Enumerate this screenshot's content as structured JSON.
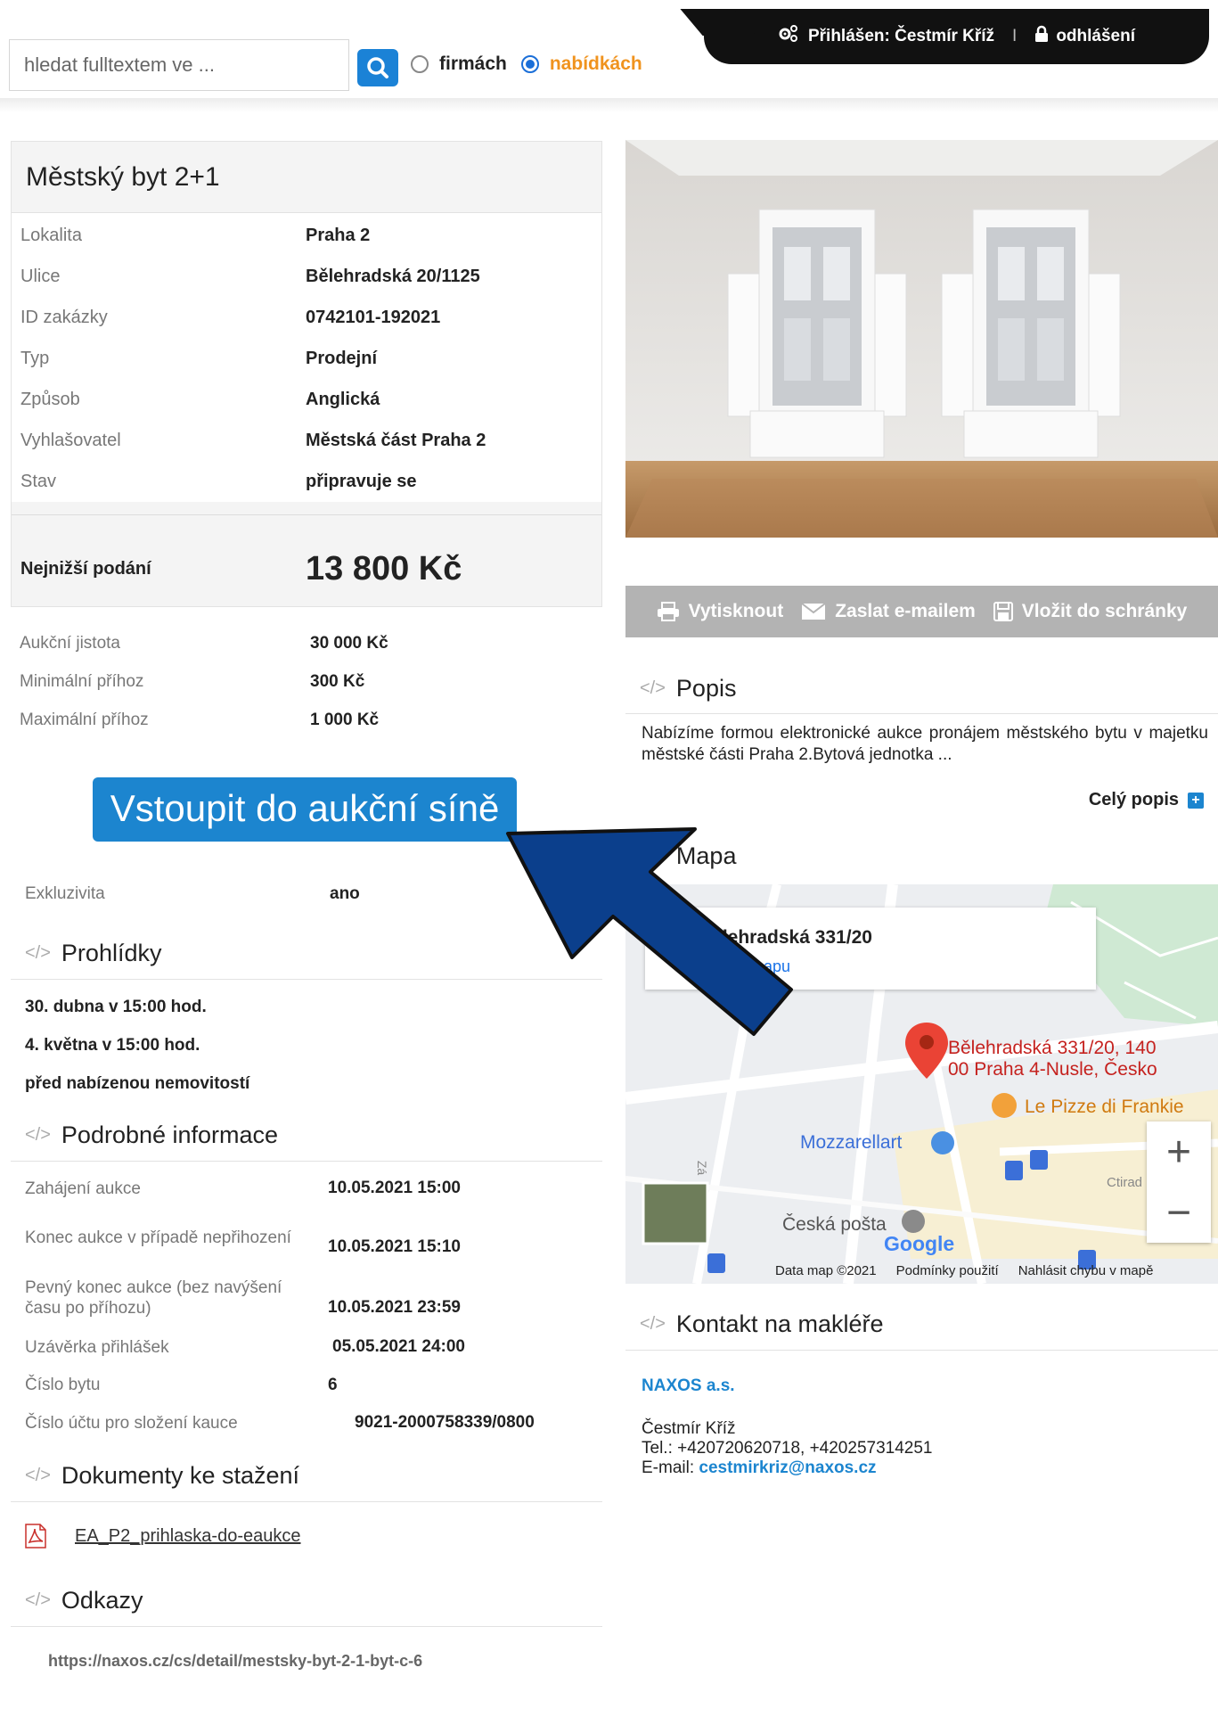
{
  "search": {
    "placeholder": "hledat fulltextem ve ...",
    "options": [
      {
        "label": "firmách",
        "selected": false
      },
      {
        "label": "nabídkách",
        "selected": true
      }
    ]
  },
  "user": {
    "logged_in": "Přihlášen: Čestmír Kříž",
    "separator": "I",
    "logout": "odhlášení"
  },
  "listing": {
    "title": "Městský byt 2+1",
    "fields": [
      {
        "label": "Lokalita",
        "value": "Praha 2"
      },
      {
        "label": "Ulice",
        "value": "Bělehradská 20/1125"
      },
      {
        "label": "ID zakázky",
        "value": "0742101-192021"
      },
      {
        "label": "Typ",
        "value": "Prodejní"
      },
      {
        "label": "Způsob",
        "value": "Anglická"
      },
      {
        "label": "Vyhlašovatel",
        "value": "Městská část Praha 2"
      },
      {
        "label": "Stav",
        "value": "připravuje se"
      }
    ],
    "min_bid_label": "Nejnižší podání",
    "min_bid_value": "13 800 Kč"
  },
  "auction": {
    "rows": [
      {
        "label": "Aukční jistota",
        "value": "30 000 Kč"
      },
      {
        "label": "Minimální příhoz",
        "value": "300 Kč"
      },
      {
        "label": "Maximální příhoz",
        "value": "1 000 Kč"
      }
    ],
    "enter_button": "Vstoupit do aukční síně",
    "exclusivity_label": "Exkluzivita",
    "exclusivity_value": "ano"
  },
  "visits": {
    "heading": "Prohlídky",
    "items": [
      "30. dubna v 15:00 hod.",
      "4. května v 15:00 hod.",
      "před nabízenou nemovitostí"
    ]
  },
  "details": {
    "heading": "Podrobné informace",
    "rows": [
      {
        "label": "Zahájení aukce",
        "value": "10.05.2021 15:00"
      },
      {
        "label": "Konec aukce v případě nepřihození",
        "value": "10.05.2021 15:10"
      },
      {
        "label": "Pevný konec aukce (bez navýšení času po příhozu)",
        "value": "10.05.2021 23:59"
      },
      {
        "label": "Uzávěrka přihlášek",
        "value": "05.05.2021 24:00"
      },
      {
        "label": "Číslo bytu",
        "value": "6"
      },
      {
        "label": "Číslo účtu pro složení kauce",
        "value": "9021-2000758339/0800"
      }
    ]
  },
  "documents": {
    "heading": "Dokumenty ke stažení",
    "items": [
      "EA_P2_prihlaska-do-eaukce"
    ]
  },
  "links": {
    "heading": "Odkazy",
    "url": "https://naxos.cz/cs/detail/mestsky-byt-2-1-byt-c-6"
  },
  "toolbar": {
    "print": "Vytisknout",
    "email": "Zaslat e-mailem",
    "clipboard": "Vložit do schránky"
  },
  "description": {
    "heading": "Popis",
    "text": "Nabízíme formou elektronické aukce pronájem městského bytu v majetku městské části Praha 2.Bytová jednotka ...",
    "full_link": "Celý popis"
  },
  "map": {
    "heading": "Mapa",
    "card_title": "Bělehradská 331/20",
    "card_link": "Zvětšit mapu",
    "pin_label_1": "Bělehradská 331/20, 140",
    "pin_label_2": "00 Praha 4-Nusle, Česko",
    "poi_pizza": "Le Pizze di Frankie",
    "poi_mozzarella": "Mozzarellart",
    "poi_post": "Česká pošta",
    "poi_ctirad": "Ctirad",
    "street_vert": "Zá",
    "google": "Google",
    "footer_data": "Data map ©2021",
    "footer_terms": "Podmínky použití",
    "footer_report": "Nahlásit chybu v mapě",
    "zoom_in": "+",
    "zoom_out": "−"
  },
  "contact": {
    "heading": "Kontakt na makléře",
    "company": "NAXOS a.s.",
    "name": "Čestmír Kříž",
    "phone": "Tel.: +420720620718, +420257314251",
    "email_label": "E-mail: ",
    "email": "cestmirkriz@naxos.cz"
  },
  "colors": {
    "accent_blue": "#1c85cf",
    "offer_orange": "#f0931e",
    "arrow_blue": "#0b3f8c"
  }
}
